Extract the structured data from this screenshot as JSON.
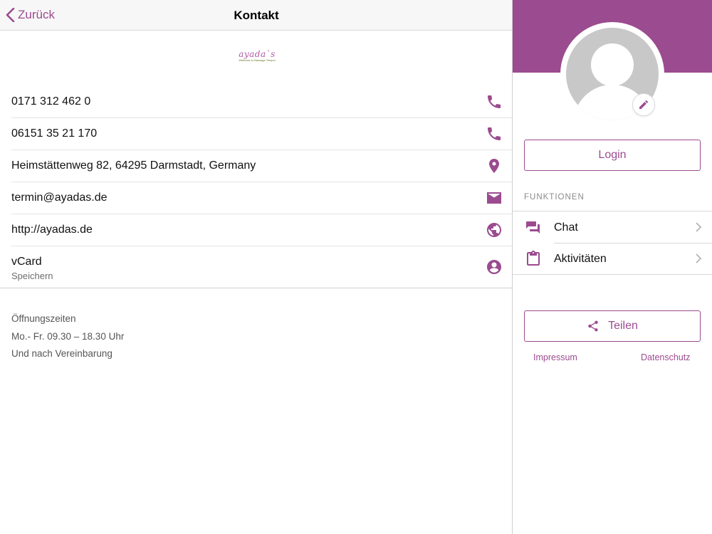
{
  "nav": {
    "back_label": "Zurück",
    "title": "Kontakt"
  },
  "logo": {
    "brand": "ayada`s",
    "tagline": "Wellness & Massage Tempel"
  },
  "contacts": [
    {
      "text": "0171 312 462 0",
      "icon": "phone-icon"
    },
    {
      "text": "06151 35 21 170",
      "icon": "phone-icon"
    },
    {
      "text": "Heimstättenweg 82, 64295 Darmstadt, Germany",
      "icon": "location-pin-icon"
    },
    {
      "text": "termin@ayadas.de",
      "icon": "mail-icon"
    },
    {
      "text": "http://ayadas.de",
      "icon": "globe-icon"
    },
    {
      "text": "vCard",
      "subtext": "Speichern",
      "icon": "account-circle-icon"
    }
  ],
  "hours": [
    "Öffnungszeiten",
    "Mo.- Fr. 09.30 – 18.30 Uhr",
    "Und nach Vereinbarung"
  ],
  "sidebar": {
    "login_label": "Login",
    "section_title": "FUNKTIONEN",
    "menu": [
      {
        "label": "Chat",
        "icon": "chat-icon"
      },
      {
        "label": "Aktivitäten",
        "icon": "clipboard-icon"
      }
    ],
    "share_label": "Teilen",
    "impressum_label": "Impressum",
    "datenschutz_label": "Datenschutz"
  },
  "colors": {
    "accent": "#9b4b8f",
    "navbar_bg": "#f7f7f7",
    "avatar_bg": "#c8c8c8"
  }
}
